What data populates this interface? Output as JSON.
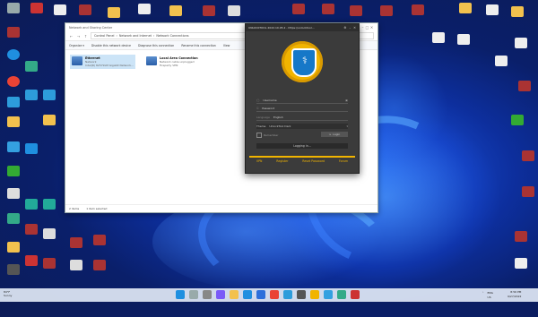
{
  "explorer": {
    "title": "Network and Sharing Center",
    "tab": "Network Connections",
    "breadcrumb": [
      "Control Panel",
      "Network and Internet",
      "Network Connections"
    ],
    "commands": [
      "Organize ▾",
      "Disable this network device",
      "Diagnose this connection",
      "Rename this connection",
      "View"
    ],
    "adapters": [
      {
        "name": "Ethernet",
        "status": "Network",
        "device": "Intel(R) 82579LM Gigabit Network..."
      },
      {
        "name": "Local Area Connection",
        "status": "Network cable unplugged",
        "device": "Fireparty VPN"
      }
    ],
    "status_items": "2 items",
    "status_selected": "1 item selected"
  },
  "tool": {
    "title": "UNLOCKTOOL 2022.10.05.2 - https://unlocktool...",
    "username_label": "Username",
    "password_label": "Password",
    "language_label": "Language",
    "language_value": "English",
    "theme_label": "Theme",
    "theme_value": "UnlockTool Dark",
    "remember_label": "Remember",
    "login_label": "Login",
    "progress_text": "Logging in...",
    "links": [
      "VPN",
      "Register",
      "Reset Password",
      "Forum"
    ]
  },
  "taskbar": {
    "weather_temp": "84°F",
    "weather_desc": "Sunny",
    "lang": "ENG",
    "region": "US",
    "time": "8:56 PM",
    "date": "9/27/2022"
  },
  "colors": {
    "accent": "#f1b400",
    "tool_bg": "#3b3b3b",
    "shield": "#1678c8"
  }
}
